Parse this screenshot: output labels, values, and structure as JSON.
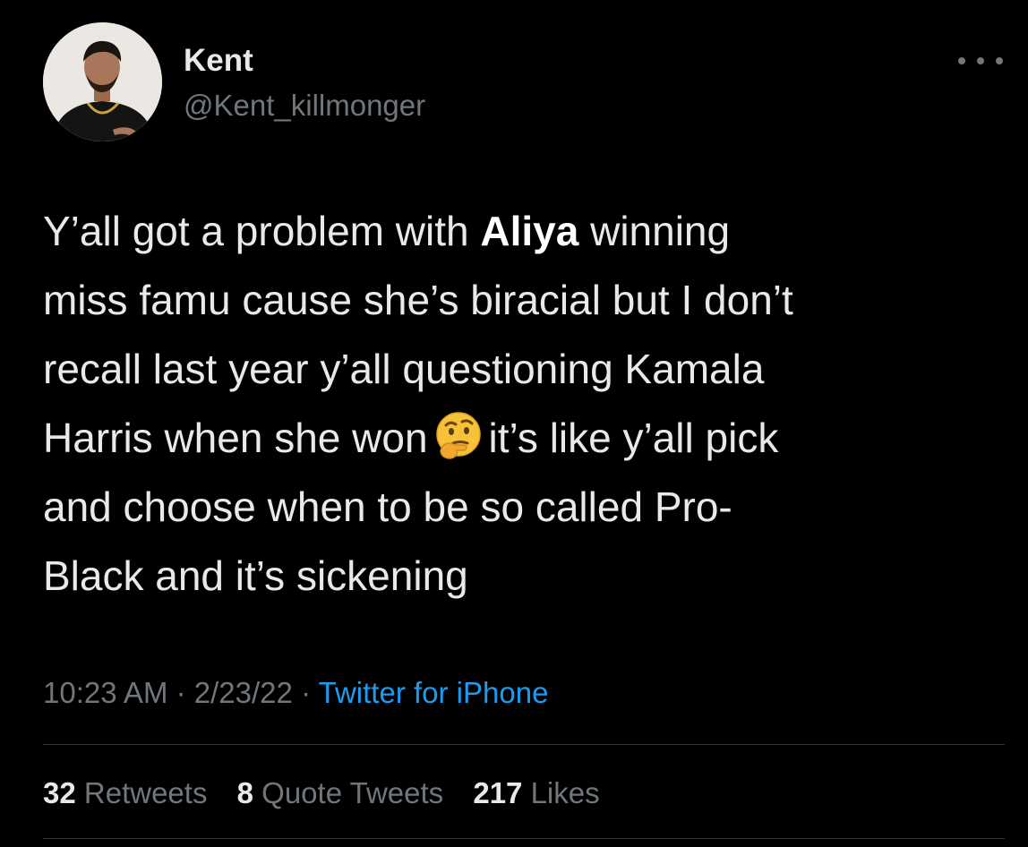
{
  "author": {
    "display_name": "Kent",
    "handle": "@Kent_killmonger",
    "avatar_icon": "profile-photo"
  },
  "more_icon": "ellipsis-icon",
  "tweet": {
    "lines": [
      [
        "Y’all got a problem with ",
        "Aliya",
        " winning"
      ],
      "miss famu cause she’s biracial but I don’t",
      "recall last year y’all questioning Kamala",
      [
        "Harris when she won",
        "it’s like y’all pick"
      ],
      "and choose when to be so called Pro-",
      "Black and it’s sickening"
    ],
    "emoji": "thinking-face"
  },
  "meta": {
    "time": "10:23 AM",
    "separator": "·",
    "date": "2/23/22",
    "source": "Twitter for iPhone"
  },
  "stats": {
    "retweets": {
      "count": "32",
      "label": "Retweets"
    },
    "quote_tweets": {
      "count": "8",
      "label": "Quote Tweets"
    },
    "likes": {
      "count": "217",
      "label": "Likes"
    }
  },
  "colors": {
    "background": "#000000",
    "text": "#e7e9ea",
    "secondary": "#71767b",
    "link": "#1d9bf0",
    "divider": "#2f3336"
  }
}
